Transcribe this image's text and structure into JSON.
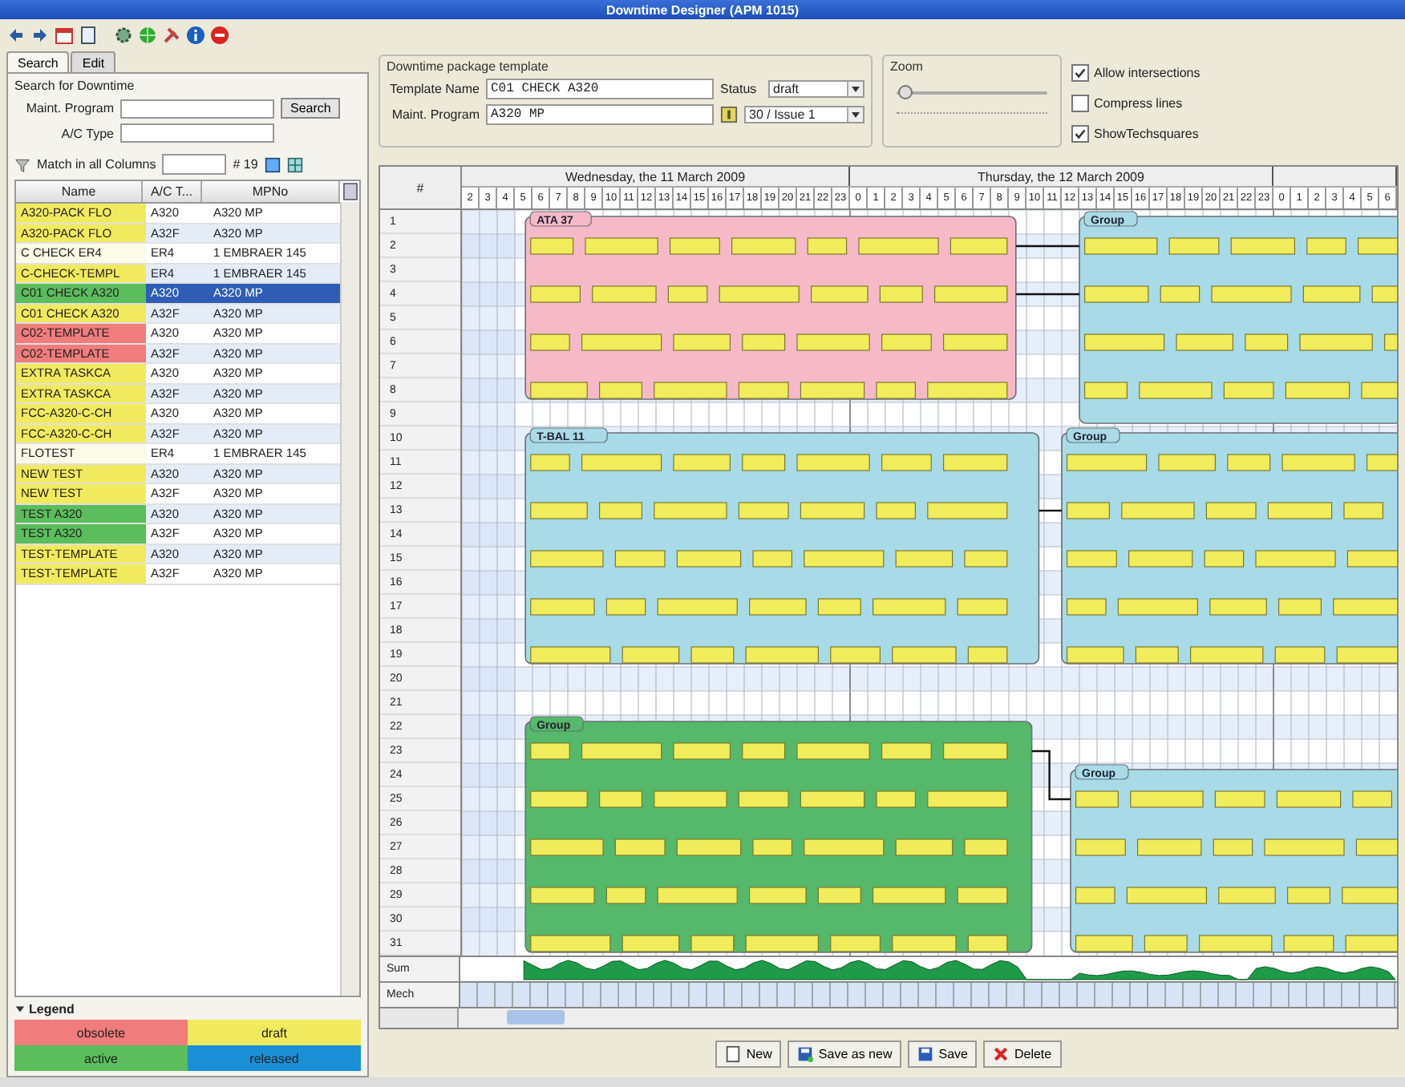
{
  "window": {
    "title": "Downtime Designer (APM 1015)"
  },
  "left_panel": {
    "tabs": [
      {
        "label": "Search",
        "selected": true
      },
      {
        "label": "Edit",
        "selected": false
      }
    ],
    "search": {
      "title": "Search for Downtime",
      "maint_program_label": "Maint. Program",
      "search_button": "Search",
      "ac_type_label": "A/C Type",
      "match_label": "Match in all Columns",
      "count": "# 19"
    },
    "table": {
      "columns": [
        "Name",
        "A/C T...",
        "MPNo"
      ],
      "rows": [
        {
          "name": "A320-PACK FLO",
          "ac_type": "A320",
          "mpno": "A320 MP",
          "color": "#f2ea5e",
          "selected": false
        },
        {
          "name": "A320-PACK FLO",
          "ac_type": "A32F",
          "mpno": "A320 MP",
          "color": "#f2ea5e",
          "selected": false
        },
        {
          "name": "C CHECK ER4",
          "ac_type": "ER4",
          "mpno": "1 EMBRAER 145",
          "color": "#fbfbe8",
          "selected": false
        },
        {
          "name": "C-CHECK-TEMPL",
          "ac_type": "ER4",
          "mpno": "1 EMBRAER 145",
          "color": "#f2ea5e",
          "selected": false
        },
        {
          "name": "C01 CHECK A320",
          "ac_type": "A320",
          "mpno": "A320 MP",
          "color": "#5bbd5b",
          "selected": true
        },
        {
          "name": "C01 CHECK A320",
          "ac_type": "A32F",
          "mpno": "A320 MP",
          "color": "#f2ea5e",
          "selected": false
        },
        {
          "name": "C02-TEMPLATE",
          "ac_type": "A320",
          "mpno": "A320 MP",
          "color": "#f07c7c",
          "selected": false
        },
        {
          "name": "C02-TEMPLATE",
          "ac_type": "A32F",
          "mpno": "A320 MP",
          "color": "#f07c7c",
          "selected": false
        },
        {
          "name": "EXTRA TASKCA",
          "ac_type": "A320",
          "mpno": "A320 MP",
          "color": "#f2ea5e",
          "selected": false
        },
        {
          "name": "EXTRA TASKCA",
          "ac_type": "A32F",
          "mpno": "A320 MP",
          "color": "#f2ea5e",
          "selected": false
        },
        {
          "name": "FCC-A320-C-CH",
          "ac_type": "A320",
          "mpno": "A320 MP",
          "color": "#f2ea5e",
          "selected": false
        },
        {
          "name": "FCC-A320-C-CH",
          "ac_type": "A32F",
          "mpno": "A320 MP",
          "color": "#f2ea5e",
          "selected": false
        },
        {
          "name": "FLOTEST",
          "ac_type": "ER4",
          "mpno": "1 EMBRAER 145",
          "color": "#fbfbe8",
          "selected": false
        },
        {
          "name": "NEW TEST",
          "ac_type": "A320",
          "mpno": "A320 MP",
          "color": "#f2ea5e",
          "selected": false
        },
        {
          "name": "NEW TEST",
          "ac_type": "A32F",
          "mpno": "A320 MP",
          "color": "#f2ea5e",
          "selected": false
        },
        {
          "name": "TEST A320",
          "ac_type": "A320",
          "mpno": "A320 MP",
          "color": "#5bbd5b",
          "selected": false
        },
        {
          "name": "TEST A320",
          "ac_type": "A32F",
          "mpno": "A320 MP",
          "color": "#5bbd5b",
          "selected": false
        },
        {
          "name": "TEST-TEMPLATE",
          "ac_type": "A320",
          "mpno": "A320 MP",
          "color": "#f2ea5e",
          "selected": false
        },
        {
          "name": "TEST-TEMPLATE",
          "ac_type": "A32F",
          "mpno": "A320 MP",
          "color": "#f2ea5e",
          "selected": false
        }
      ]
    },
    "legend": {
      "title": "Legend",
      "items": [
        {
          "label": "obsolete",
          "color": "#f07c7c"
        },
        {
          "label": "draft",
          "color": "#f2ea5e"
        },
        {
          "label": "active",
          "color": "#5bbd5b"
        },
        {
          "label": "released",
          "color": "#1a8fd6"
        }
      ]
    }
  },
  "template": {
    "title": "Downtime package template",
    "template_name_label": "Template Name",
    "template_name": "C01 CHECK A320",
    "status_label": "Status",
    "status": "draft",
    "maint_program_label": "Maint. Program",
    "maint_program": "A320 MP",
    "issue": "30 / Issue 1"
  },
  "zoom": {
    "label": "Zoom",
    "level": 0.02
  },
  "options": [
    {
      "label": "Allow intersections",
      "checked": true
    },
    {
      "label": "Compress lines",
      "checked": false
    },
    {
      "label": "ShowTechsquares",
      "checked": true
    }
  ],
  "gantt": {
    "corner": "#",
    "days": [
      {
        "label": "Wednesday, the 11 March 2009",
        "hours": [
          "2",
          "3",
          "4",
          "5",
          "6",
          "7",
          "8",
          "9",
          "10",
          "11",
          "12",
          "13",
          "14",
          "15",
          "16",
          "17",
          "18",
          "19",
          "20",
          "21",
          "22",
          "23"
        ]
      },
      {
        "label": "Thursday, the 12 March 2009",
        "hours": [
          "0",
          "1",
          "2",
          "3",
          "4",
          "5",
          "6",
          "7",
          "8",
          "9",
          "10",
          "11",
          "12",
          "13",
          "14",
          "15",
          "16",
          "17",
          "18",
          "19",
          "20",
          "21",
          "22",
          "23"
        ]
      },
      {
        "hours": [
          "0",
          "1",
          "2",
          "3",
          "4",
          "5",
          "6"
        ]
      }
    ],
    "rows": [
      "1",
      "2",
      "3",
      "4",
      "5",
      "6",
      "7",
      "8",
      "9",
      "10",
      "11",
      "12",
      "13",
      "14",
      "15",
      "16",
      "17",
      "18",
      "19",
      "20",
      "21",
      "22",
      "23",
      "24",
      "25",
      "26",
      "27",
      "28",
      "29",
      "30",
      "31"
    ],
    "groups": [
      {
        "label": "ATA 37",
        "color": "#f5b9c8"
      },
      {
        "label": "Group",
        "color": "#a8dbe7"
      },
      {
        "label": "T-BAL 11",
        "color": "#a8dbe7"
      },
      {
        "label": "Group",
        "color": "#a8dbe7"
      },
      {
        "label": "Group",
        "color": "#55b86a"
      },
      {
        "label": "Group",
        "color": "#a8dbe7"
      }
    ],
    "summary_rows": [
      "Sum",
      "Mech"
    ]
  },
  "buttons": [
    "New",
    "Save as new",
    "Save",
    "Delete"
  ]
}
